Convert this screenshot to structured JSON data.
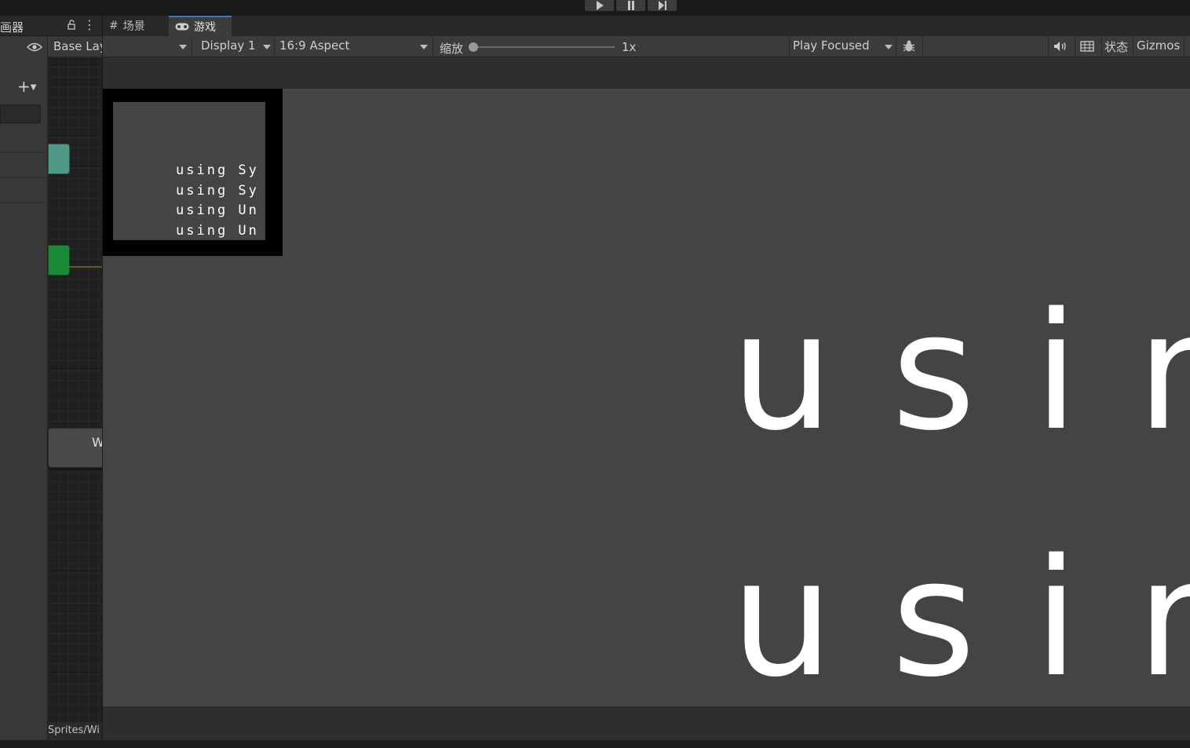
{
  "toolbar_top": {
    "play_icon": "play-icon",
    "pause_icon": "pause-icon",
    "step_icon": "step-icon"
  },
  "left_panel": {
    "tab_label": "画器",
    "lock_icon": "lock-icon",
    "menu_icon": "kebab-menu-icon",
    "eye_icon": "eye-icon",
    "add_button": "+▾",
    "base_layer": "Base Layer",
    "state_label": "W",
    "path": "Sprites/Wi"
  },
  "game_panel": {
    "tabs": [
      {
        "icon": "grid-icon",
        "label": "场景"
      },
      {
        "icon": "gamepad-icon",
        "label": "游戏"
      }
    ],
    "toolbar": {
      "display": "Display 1",
      "aspect": "16:9 Aspect",
      "zoom_label": "缩放",
      "zoom_value": "1x",
      "zoom_level": 0.0,
      "play_mode": "Play Focused",
      "bug_icon": "bug-icon",
      "audio_icon": "speaker-icon",
      "stats_grid_icon": "grid-icon",
      "stats": "状态",
      "gizmos": "Gizmos"
    },
    "minimap_lines": [
      "using Sy",
      "using Sy",
      "using Un",
      "using Un"
    ],
    "big_lines": [
      "using",
      "using"
    ],
    "colors": {
      "background": "#191919",
      "panel": "#3c3c3c",
      "viewport": "#444444",
      "active_tab_accent": "#3a79bb",
      "state_teal": "#4e9a86",
      "state_green": "#1b8a36"
    }
  }
}
